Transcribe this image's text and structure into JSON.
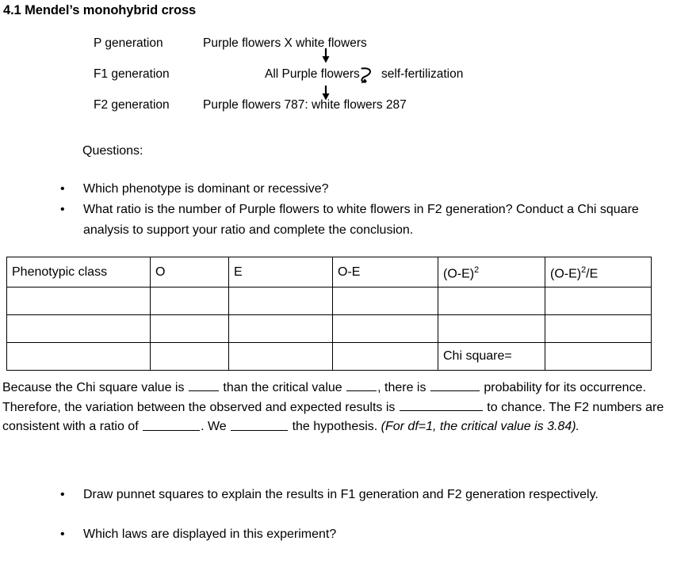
{
  "document": {
    "title": "4.1 Mendel’s monohybrid cross"
  },
  "cross_diagram": {
    "rows": [
      {
        "generation_label": "P generation",
        "content": "Purple flowers X white flowers"
      },
      {
        "generation_label": "F1 generation",
        "content": "All Purple flowers"
      },
      {
        "generation_label": "F2 generation",
        "content": "Purple flowers 787: white flowers 287"
      }
    ],
    "self_fertilization_label": "self-fertilization",
    "arrow_icon_name": "down-arrow-icon",
    "self_fert_icon_name": "curved-self-fertilization-arrow-icon"
  },
  "questions": {
    "heading": "Questions:",
    "items": [
      "Which phenotype is dominant or recessive?",
      "What ratio is the number of Purple flowers to white flowers in F2 generation? Conduct a Chi square analysis to support your ratio and complete the conclusion."
    ]
  },
  "chi_table": {
    "headers": [
      {
        "text": "Phenotypic class",
        "sup": ""
      },
      {
        "text": "O",
        "sup": ""
      },
      {
        "text": "E",
        "sup": ""
      },
      {
        "text": "O-E",
        "sup": ""
      },
      {
        "text": "(O-E)",
        "sup": "2"
      },
      {
        "text": "(O-E)",
        "sup": "2",
        "suffix": "/E"
      }
    ],
    "header_5_label": "(O-E)2",
    "header_6_label": "(O-E)2/E",
    "rows": [
      [
        "",
        "",
        "",
        "",
        "",
        ""
      ],
      [
        "",
        "",
        "",
        "",
        "",
        ""
      ],
      [
        "",
        "",
        "",
        "",
        "Chi square=",
        ""
      ]
    ],
    "chi_square_label": "Chi square="
  },
  "conclusion": {
    "seg1": "Because the Chi square value is ",
    "seg2": " than the critical value ",
    "seg3": ", there is ",
    "seg4": " probability for its occurrence. Therefore, the variation between the observed and expected results is ",
    "seg5": " to chance. The F2 numbers are consistent with a ratio of ",
    "seg6": ". We ",
    "seg7": " the hypothesis. ",
    "seg8": "(For df=1, the critical value is 3.84).",
    "blank_placeholder": "______"
  },
  "final_questions": {
    "items": [
      "Draw punnet squares to explain the results in F1 generation and F2 generation respectively.",
      "Which laws are displayed in this experiment?"
    ]
  },
  "colors": {
    "text": "#000000",
    "background": "#ffffff",
    "table_border": "#000000"
  }
}
